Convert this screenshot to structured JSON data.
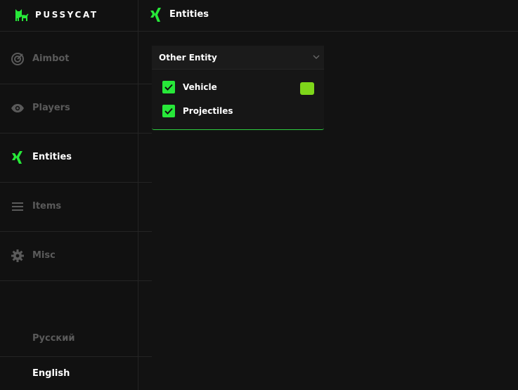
{
  "brand": {
    "name": "PUSSYCAT",
    "logo_icon": "cat-icon"
  },
  "colors": {
    "accent": "#27e839",
    "vehicle_swatch": "#7ed61a",
    "muted": "#5a5a5a"
  },
  "sidebar": {
    "items": [
      {
        "label": "Aimbot",
        "icon": "target-icon"
      },
      {
        "label": "Players",
        "icon": "eye-icon"
      },
      {
        "label": "Entities",
        "icon": "xing-icon",
        "active": true
      },
      {
        "label": "Items",
        "icon": "menu-icon"
      },
      {
        "label": "Misc",
        "icon": "gear-icon"
      }
    ],
    "languages": [
      {
        "label": "Русский"
      },
      {
        "label": "English",
        "active": true
      }
    ]
  },
  "header": {
    "title": "Entities",
    "icon": "xing-icon"
  },
  "panel": {
    "title": "Other Entity",
    "options": [
      {
        "label": "Vehicle",
        "checked": true
      },
      {
        "label": "Projectiles",
        "checked": true
      }
    ]
  }
}
